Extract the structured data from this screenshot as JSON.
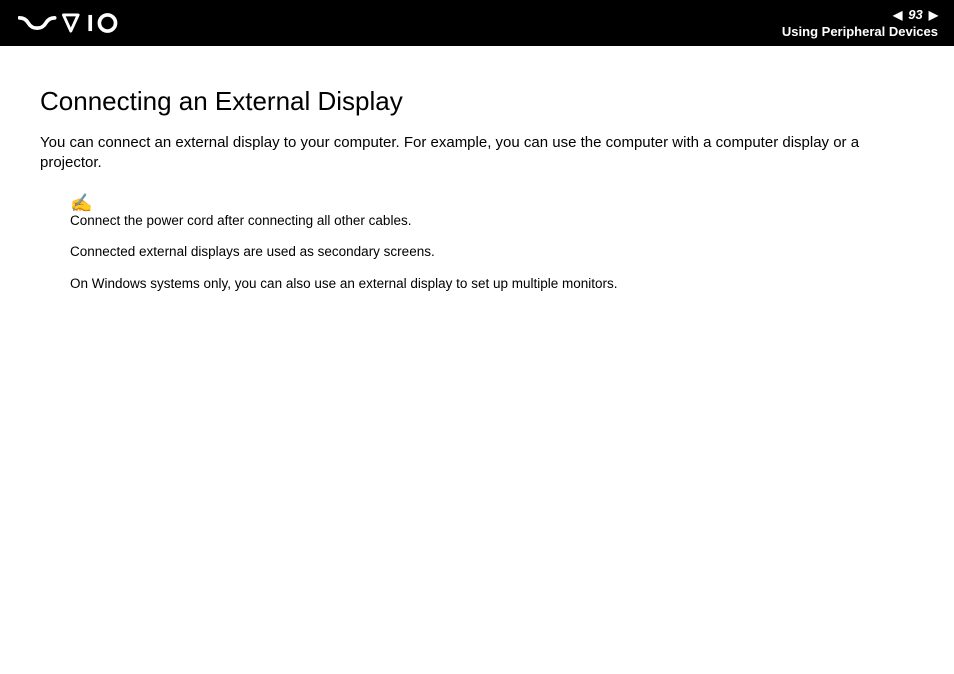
{
  "header": {
    "page_number": "93",
    "section": "Using Peripheral Devices"
  },
  "content": {
    "title": "Connecting an External Display",
    "intro": "You can connect an external display to your computer. For example, you can use the computer with a computer display or a projector.",
    "notes": {
      "line1": "Connect the power cord after connecting all other cables.",
      "line2": "Connected external displays are used as secondary screens.",
      "line3": "On Windows systems only, you can also use an external display to set up multiple monitors."
    }
  }
}
